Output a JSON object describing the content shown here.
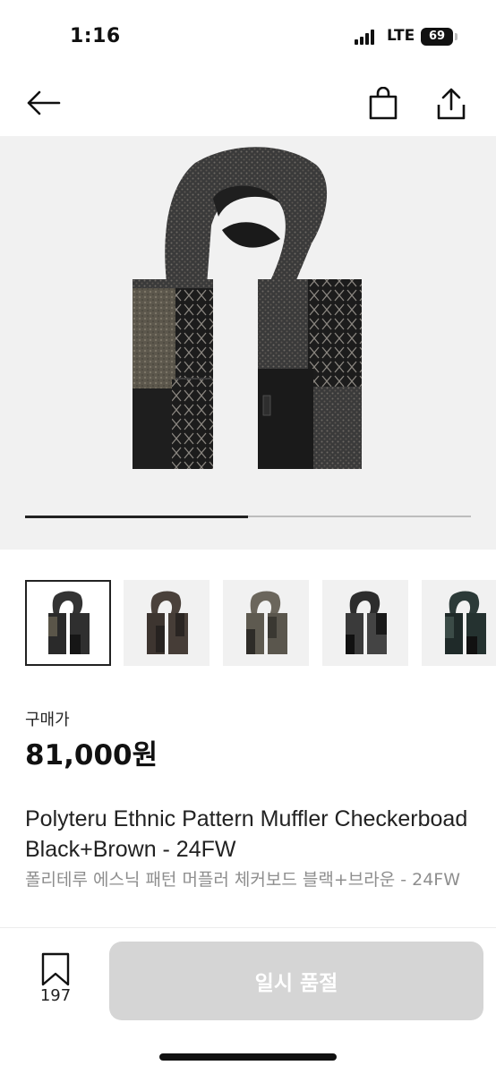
{
  "status_bar": {
    "time": "1:16",
    "network": "LTE",
    "battery": "69"
  },
  "nav": {
    "back_icon": "arrow-left-icon",
    "bag_icon": "shopping-bag-icon",
    "share_icon": "share-icon"
  },
  "gallery": {
    "image": "scarf-image",
    "progress": 0.5,
    "thumbnails": [
      {
        "name": "thumb-1",
        "selected": true
      },
      {
        "name": "thumb-2",
        "selected": false
      },
      {
        "name": "thumb-3",
        "selected": false
      },
      {
        "name": "thumb-4",
        "selected": false
      },
      {
        "name": "thumb-5",
        "selected": false
      }
    ]
  },
  "price": {
    "label": "구매가",
    "value": "81,000원"
  },
  "product": {
    "title_en": "Polyteru Ethnic Pattern Muffler Checkerboad Black+Brown - 24FW",
    "title_ko": "폴리테루 에스닉 패턴 머플러 체커보드 블랙+브라운 - 24FW"
  },
  "bottom_bar": {
    "bookmark_count": "197",
    "button_label": "일시 품절"
  },
  "colors": {
    "button_disabled": "#d5d5d5",
    "gallery_bg": "#f1f1f1",
    "text_secondary": "#8e8e8e"
  }
}
